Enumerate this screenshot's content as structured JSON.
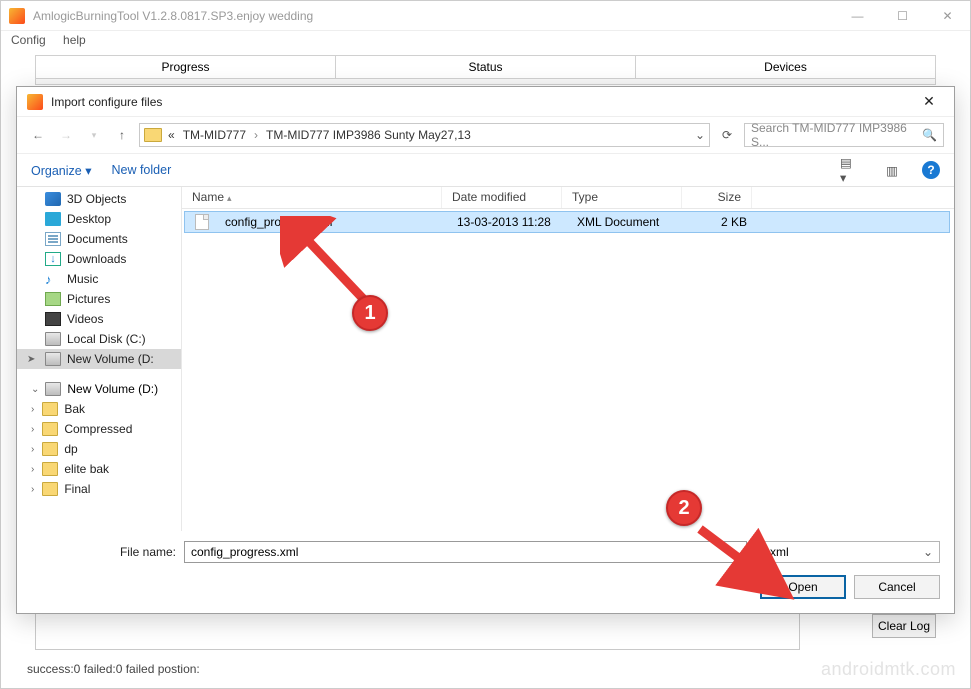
{
  "app": {
    "title": "AmlogicBurningTool  V1.2.8.0817.SP3.enjoy wedding",
    "menu": {
      "config": "Config",
      "help": "help"
    },
    "tabs": {
      "progress": "Progress",
      "status": "Status",
      "devices": "Devices"
    },
    "clear_log": "Clear Log",
    "status_text": "success:0 failed:0 failed postion:",
    "watermark": "androidmtk.com"
  },
  "dialog": {
    "title": "Import configure files",
    "breadcrumb": {
      "prefix": "«",
      "p1": "TM-MID777",
      "p2": "TM-MID777 IMP3986 Sunty May27,13"
    },
    "search_placeholder": "Search TM-MID777 IMP3986 S...",
    "toolbar": {
      "organize": "Organize",
      "new_folder": "New folder"
    },
    "tree": {
      "items": [
        {
          "label": "3D Objects",
          "icon": "obj3d"
        },
        {
          "label": "Desktop",
          "icon": "desk"
        },
        {
          "label": "Documents",
          "icon": "doc"
        },
        {
          "label": "Downloads",
          "icon": "down"
        },
        {
          "label": "Music",
          "icon": "music"
        },
        {
          "label": "Pictures",
          "icon": "pic"
        },
        {
          "label": "Videos",
          "icon": "vid"
        },
        {
          "label": "Local Disk (C:)",
          "icon": "disk"
        },
        {
          "label": "New Volume (D:",
          "icon": "disk",
          "selected": true
        }
      ],
      "section_label": "New Volume (D:)",
      "folders": [
        "Bak",
        "Compressed",
        "dp",
        "elite bak",
        "Final"
      ]
    },
    "columns": {
      "name": "Name",
      "date": "Date modified",
      "type": "Type",
      "size": "Size"
    },
    "file": {
      "name": "config_progress.xml",
      "date": "13-03-2013 11:28",
      "type": "XML Document",
      "size": "2 KB"
    },
    "footer": {
      "file_name_label": "File name:",
      "file_name_value": "config_progress.xml",
      "filter": "*.xml",
      "open": "Open",
      "cancel": "Cancel"
    }
  },
  "annotations": {
    "badge1": "1",
    "badge2": "2"
  }
}
